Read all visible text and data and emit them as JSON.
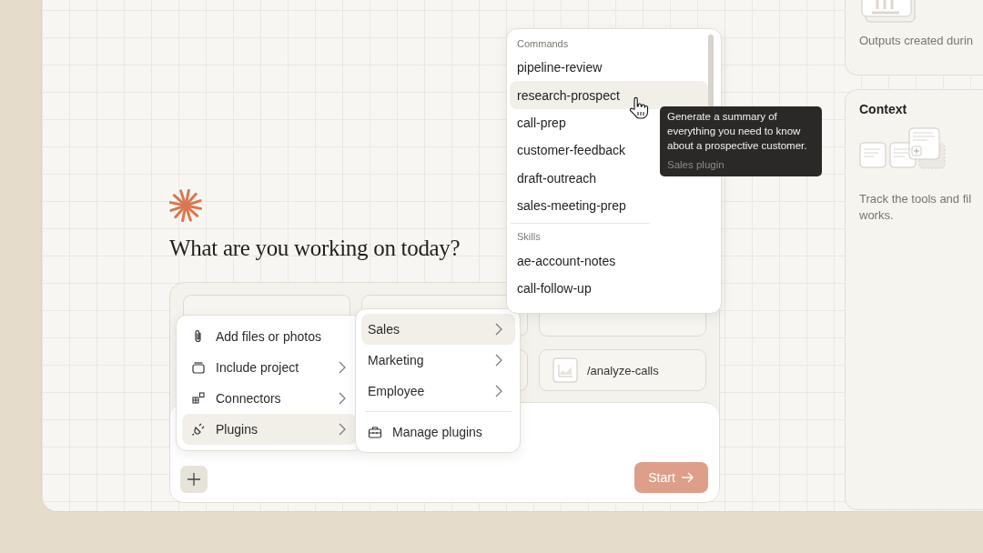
{
  "heading": "What are you working on today?",
  "suggestions": [
    {
      "kind": "covered"
    },
    {
      "kind": "covered"
    },
    {
      "kind": "covered"
    },
    {
      "kind": "hidden"
    },
    {
      "kind": "covered"
    },
    {
      "kind": "command",
      "label": "/analyze-calls"
    }
  ],
  "start_button": "Start",
  "attach_menu": [
    {
      "label": "Add files or photos",
      "submenu": false,
      "selected": false
    },
    {
      "label": "Include project",
      "submenu": true,
      "selected": false
    },
    {
      "label": "Connectors",
      "submenu": true,
      "selected": false
    },
    {
      "label": "Plugins",
      "submenu": true,
      "selected": true
    }
  ],
  "plugins_menu": {
    "items": [
      {
        "label": "Sales",
        "selected": true
      },
      {
        "label": "Marketing",
        "selected": false
      },
      {
        "label": "Employee",
        "selected": false
      }
    ],
    "manage": "Manage plugins"
  },
  "command_menu": {
    "sections": [
      {
        "title": "Commands",
        "items": [
          {
            "label": "pipeline-review",
            "selected": false
          },
          {
            "label": "research-prospect",
            "selected": true
          },
          {
            "label": "call-prep",
            "selected": false
          },
          {
            "label": "customer-feedback",
            "selected": false
          },
          {
            "label": "draft-outreach",
            "selected": false
          },
          {
            "label": "sales-meeting-prep",
            "selected": false
          }
        ]
      },
      {
        "title": "Skills",
        "items": [
          {
            "label": "ae-account-notes",
            "selected": false
          },
          {
            "label": "call-follow-up",
            "selected": false
          }
        ]
      }
    ]
  },
  "tooltip": {
    "text": "Generate a summary of everything you need to know about a prospective customer.",
    "source": "Sales plugin"
  },
  "side_cards": [
    {
      "kind": "outputs",
      "lines": [
        "Outputs created durin"
      ]
    },
    {
      "kind": "context",
      "title": "Context",
      "lines": [
        "Track the tools and fil",
        "works."
      ]
    }
  ]
}
